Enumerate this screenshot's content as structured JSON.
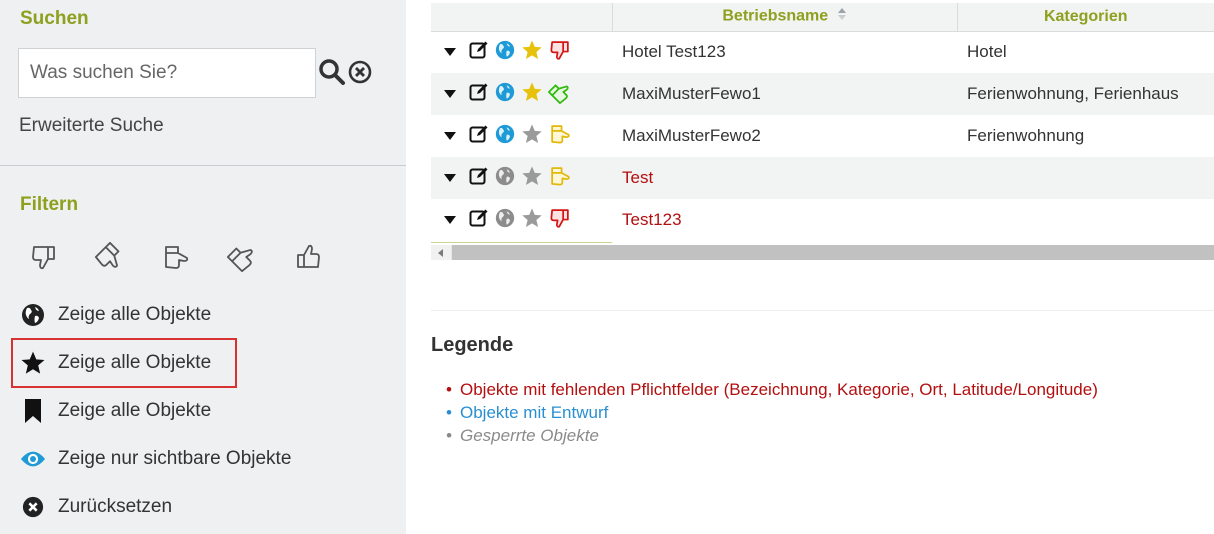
{
  "sidebar": {
    "search_heading": "Suchen",
    "search_placeholder": "Was suchen Sie?",
    "advanced_search": "Erweiterte Suche",
    "filter_heading": "Filtern",
    "filters": [
      {
        "icon": "globe-icon",
        "label": "Zeige alle Objekte"
      },
      {
        "icon": "star-icon",
        "label": "Zeige alle Objekte"
      },
      {
        "icon": "bookmark-icon",
        "label": "Zeige alle Objekte"
      },
      {
        "icon": "eye-icon",
        "label": "Zeige nur sichtbare Objekte"
      },
      {
        "icon": "reset-icon",
        "label": "Zurücksetzen"
      }
    ]
  },
  "table": {
    "columns": [
      "",
      "Betriebsname",
      "Kategorien"
    ],
    "rows": [
      {
        "name": "Hotel Test123",
        "categories": "Hotel",
        "globe": "blue",
        "star": "gold",
        "thumb": "down-red",
        "name_color": "normal"
      },
      {
        "name": "MaxiMusterFewo1",
        "categories": "Ferienwohnung, Ferienhaus",
        "globe": "blue",
        "star": "gold",
        "thumb": "up-green",
        "name_color": "normal"
      },
      {
        "name": "MaxiMusterFewo2",
        "categories": "Ferienwohnung",
        "globe": "blue",
        "star": "gray",
        "thumb": "side-yellow",
        "name_color": "normal"
      },
      {
        "name": "Test",
        "categories": "",
        "globe": "gray",
        "star": "gray",
        "thumb": "side-yellow",
        "name_color": "red"
      },
      {
        "name": "Test123",
        "categories": "",
        "globe": "gray",
        "star": "gray",
        "thumb": "down-red",
        "name_color": "red"
      }
    ]
  },
  "legend": {
    "title": "Legende",
    "items": [
      {
        "text": "Objekte mit fehlenden Pflichtfelder (Bezeichnung, Kategorie, Ort, Latitude/Longitude)",
        "color": "#b30f0f"
      },
      {
        "text": "Objekte mit Entwurf",
        "color": "#2a8fd2"
      },
      {
        "text": "Gesperrte Objekte",
        "color": "#8a8a8a"
      }
    ]
  },
  "colors": {
    "accent": "#8ea01e",
    "highlight_border": "#d83131",
    "sidebar_bg": "#eef0f1",
    "globe_blue": "#1e9bd7",
    "star_gold": "#e8c20a",
    "thumb_red": "#d11616",
    "thumb_green": "#2dbb0b",
    "thumb_yellow": "#e2b90a"
  }
}
